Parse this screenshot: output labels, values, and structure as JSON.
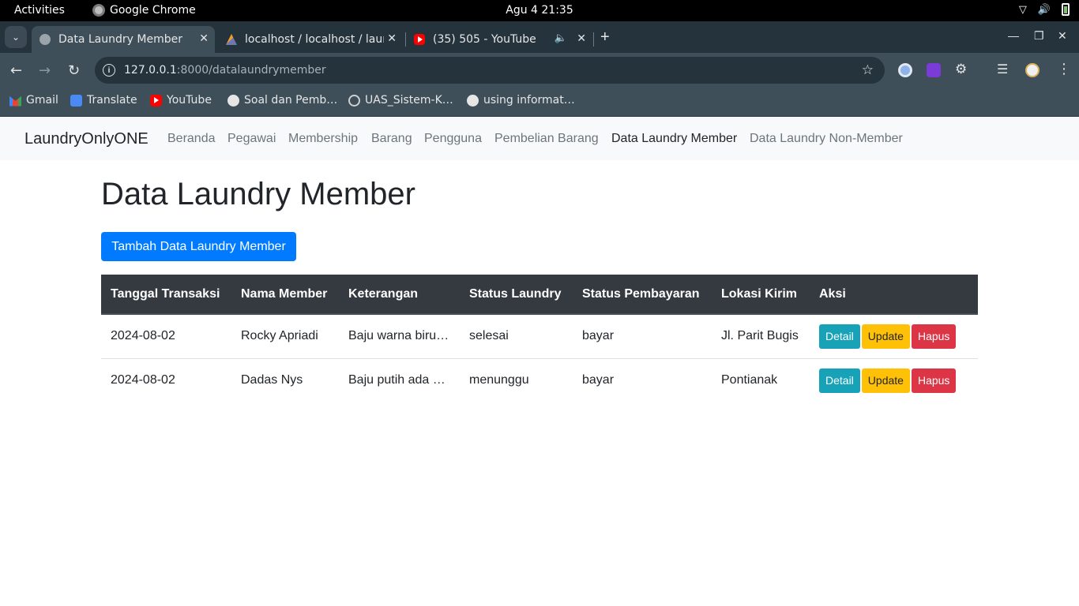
{
  "os": {
    "activities": "Activities",
    "app_name": "Google Chrome",
    "clock": "Agu 4  21:35"
  },
  "browser": {
    "tabs": [
      {
        "title": "Data Laundry Member",
        "active": true,
        "icon": "globe-icon"
      },
      {
        "title": "localhost / localhost / laundry",
        "active": false,
        "icon": "phpmyadmin-icon"
      },
      {
        "title": "(35) 505 - YouTube",
        "active": false,
        "icon": "youtube-icon",
        "audio": true
      }
    ],
    "url_host": "127.0.0.1",
    "url_path": ":8000/datalaundrymember",
    "bookmarks": [
      {
        "label": "Gmail",
        "icon": "gmail-icon"
      },
      {
        "label": "Translate",
        "icon": "translate-icon"
      },
      {
        "label": "YouTube",
        "icon": "youtube-icon"
      },
      {
        "label": "Soal dan Pemb…",
        "icon": "globe-icon"
      },
      {
        "label": "UAS_Sistem-K…",
        "icon": "uas-icon"
      },
      {
        "label": "using informat…",
        "icon": "globe-icon"
      }
    ]
  },
  "navbar": {
    "brand": "LaundryOnlyONE",
    "links": [
      "Beranda",
      "Pegawai",
      "Membership",
      "Barang",
      "Pengguna",
      "Pembelian Barang",
      "Data Laundry Member",
      "Data Laundry Non-Member"
    ],
    "active": "Data Laundry Member"
  },
  "main": {
    "title": "Data Laundry Member",
    "add_button": "Tambah Data Laundry Member",
    "table": {
      "headers": [
        "Tanggal Transaksi",
        "Nama Member",
        "Keterangan",
        "Status Laundry",
        "Status Pembayaran",
        "Lokasi Kirim",
        "Aksi"
      ],
      "rows": [
        {
          "tanggal": "2024-08-02",
          "nama": "Rocky Apriadi",
          "keterangan": "Baju warna biru…",
          "status_laundry": "selesai",
          "status_pembayaran": "bayar",
          "lokasi": "Jl. Parit Bugis"
        },
        {
          "tanggal": "2024-08-02",
          "nama": "Dadas Nys",
          "keterangan": "Baju putih ada …",
          "status_laundry": "menunggu",
          "status_pembayaran": "bayar",
          "lokasi": "Pontianak"
        }
      ],
      "actions": {
        "detail": "Detail",
        "update": "Update",
        "hapus": "Hapus"
      }
    }
  }
}
